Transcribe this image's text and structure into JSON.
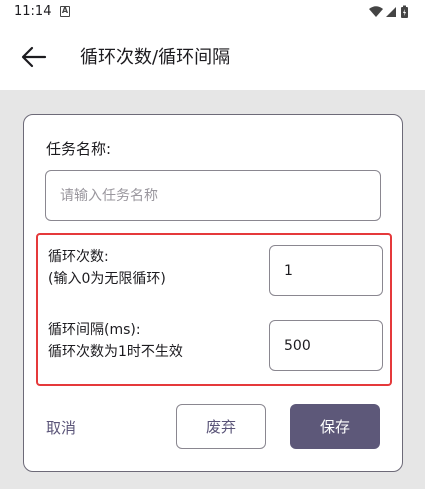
{
  "status_bar": {
    "time": "11:14",
    "notification_letter": "A",
    "icons": [
      "wifi-icon",
      "signal-icon",
      "battery-icon"
    ]
  },
  "app_bar": {
    "back_icon": "arrow-left-icon",
    "title": "循环次数/循环间隔"
  },
  "dialog": {
    "task_name_label": "任务名称:",
    "task_name_value": "",
    "task_name_placeholder": "请输入任务名称",
    "loop_count_label_line1": "循环次数:",
    "loop_count_label_line2": "(输入0为无限循环)",
    "loop_count_value": "1",
    "loop_interval_label_line1": "循环间隔(ms):",
    "loop_interval_label_line2": "循环次数为1时不生效",
    "loop_interval_value": "500",
    "cancel_label": "取消",
    "discard_label": "废弃",
    "save_label": "保存"
  },
  "colors": {
    "primary": "#5d5879",
    "highlight_border": "#e5393b",
    "scrim": "#e6e6e6"
  }
}
